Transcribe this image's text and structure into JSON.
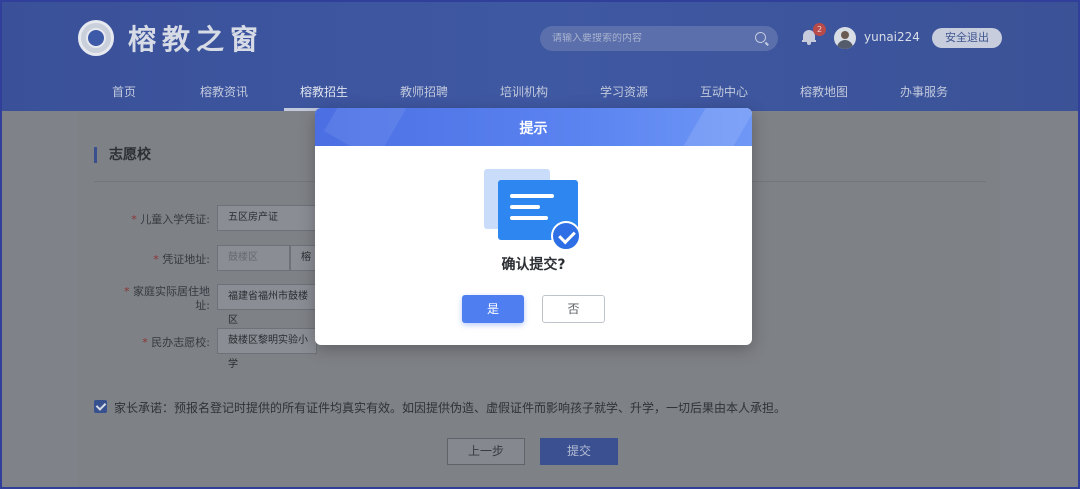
{
  "header": {
    "site_title": "榕教之窗",
    "search_placeholder": "请输入要搜索的内容",
    "notification_count": "2",
    "username": "yunai224",
    "logout_label": "安全退出"
  },
  "nav": {
    "items": [
      {
        "label": "首页"
      },
      {
        "label": "榕教资讯"
      },
      {
        "label": "榕教招生"
      },
      {
        "label": "教师招聘"
      },
      {
        "label": "培训机构"
      },
      {
        "label": "学习资源"
      },
      {
        "label": "互动中心"
      },
      {
        "label": "榕教地图"
      },
      {
        "label": "办事服务"
      }
    ],
    "active_index": 2
  },
  "form": {
    "section_title": "志愿校",
    "fields": [
      {
        "label": "儿童入学凭证:",
        "value": "五区房产证"
      },
      {
        "label": "凭证地址:",
        "value_district": "鼓楼区",
        "value_street": "榕"
      },
      {
        "label": "家庭实际居住地址:",
        "value": "福建省福州市鼓楼区"
      },
      {
        "label": "民办志愿校:",
        "value": "鼓楼区黎明实验小学"
      }
    ],
    "promise_text": "家长承诺：预报名登记时提供的所有证件均真实有效。如因提供伪造、虚假证件而影响孩子就学、升学，一切后果由本人承担。",
    "prev_button": "上一步",
    "submit_button": "提交"
  },
  "modal": {
    "title": "提示",
    "message": "确认提交?",
    "yes_label": "是",
    "no_label": "否"
  },
  "colors": {
    "header_bg": "#3f58a2",
    "modal_header": "#5b83f0",
    "primary_button": "#4f7ef0"
  }
}
